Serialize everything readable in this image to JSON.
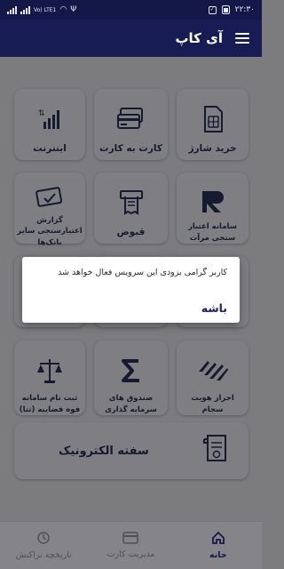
{
  "status_bar": {
    "time": "۲۲:۳۰",
    "network": "Vo) LTE1"
  },
  "app_bar": {
    "title": "آی کاپ",
    "menu_icon": "hamburger-menu-icon"
  },
  "tiles": [
    {
      "id": "internet",
      "label": "اینترنت",
      "icon": "signal-bars-icon"
    },
    {
      "id": "card-to-card",
      "label": "کارت به کارت",
      "icon": "cards-icon"
    },
    {
      "id": "buy-charge",
      "label": "خرید شارژ",
      "icon": "sim-card-icon"
    },
    {
      "id": "credit-report",
      "label": "گزارش اعتبارسنجی سایر بانک‌ها",
      "icon": "card-check-icon"
    },
    {
      "id": "bills",
      "label": "قبوض",
      "icon": "receipt-icon"
    },
    {
      "id": "mirat",
      "label": "سامانه اعتبار سنجی مرآت",
      "icon": "mirat-logo-icon"
    },
    {
      "id": "sana",
      "label": "ثبت نام سامانه قوه قضاییه (ثنا)",
      "icon": "scales-icon"
    },
    {
      "id": "funds",
      "label": "صندوق های سرمایه گذاری",
      "icon": "sigma-icon"
    },
    {
      "id": "sejam",
      "label": "احراز هویت سجام",
      "icon": "sejam-logo-icon"
    }
  ],
  "wide_tile": {
    "label": "سفته الکترونیک",
    "icon": "document-icon"
  },
  "bottom_nav": [
    {
      "label": "تاریخچه تراکنش",
      "icon": "history-icon",
      "active": false
    },
    {
      "label": "مدیریت کارت",
      "icon": "card-icon",
      "active": false
    },
    {
      "label": "خانه",
      "icon": "home-icon",
      "active": true
    }
  ],
  "dialog": {
    "message": "کاربر گرامی بزودی این سرویس فعال خواهد شد",
    "ok_label": "باشه"
  },
  "colors": {
    "app_bar": "#181c54",
    "accent": "#1b2070",
    "overlay_bg": "#7c7c7f"
  }
}
